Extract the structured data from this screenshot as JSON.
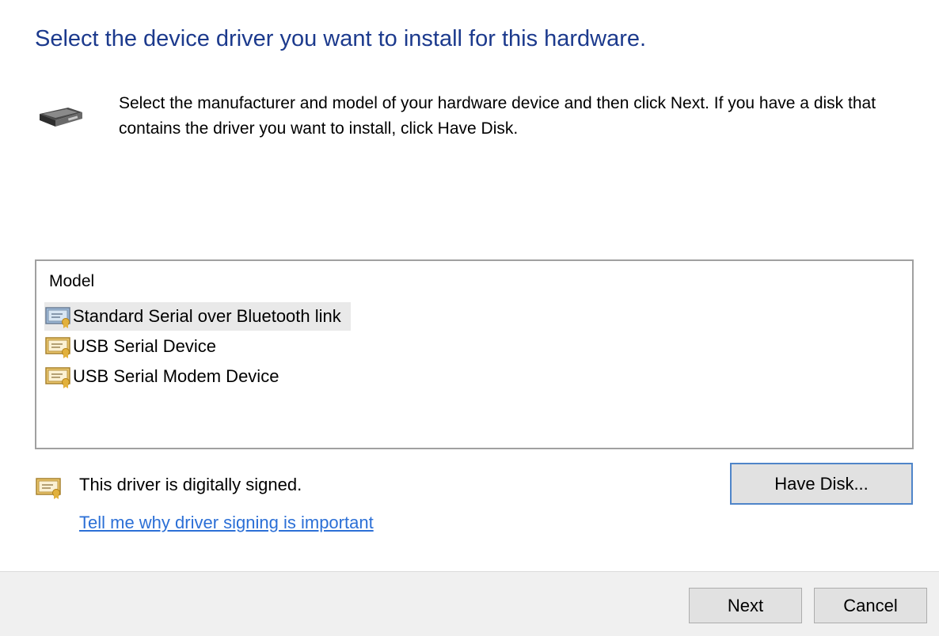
{
  "header": {
    "title": "Select the device driver you want to install for this hardware.",
    "hardware_icon": "hardware-device-icon"
  },
  "description": "Select the manufacturer and model of your hardware device and then click Next. If you have a disk that contains the driver you want to install, click Have Disk.",
  "model_list": {
    "column_header": "Model",
    "selected_index": 0,
    "items": [
      {
        "label": "Standard Serial over Bluetooth link",
        "icon": "certificate-icon"
      },
      {
        "label": "USB Serial Device",
        "icon": "certificate-icon"
      },
      {
        "label": "USB Serial Modem Device",
        "icon": "certificate-icon"
      }
    ]
  },
  "signing": {
    "status_text": "This driver is digitally signed.",
    "status_icon": "certificate-icon",
    "link_text": "Tell me why driver signing is important"
  },
  "buttons": {
    "have_disk": "Have Disk...",
    "next": "Next",
    "cancel": "Cancel"
  },
  "colors": {
    "title": "#1c3a8d",
    "link": "#2b6fd6",
    "selection": "#e9e9e9"
  }
}
